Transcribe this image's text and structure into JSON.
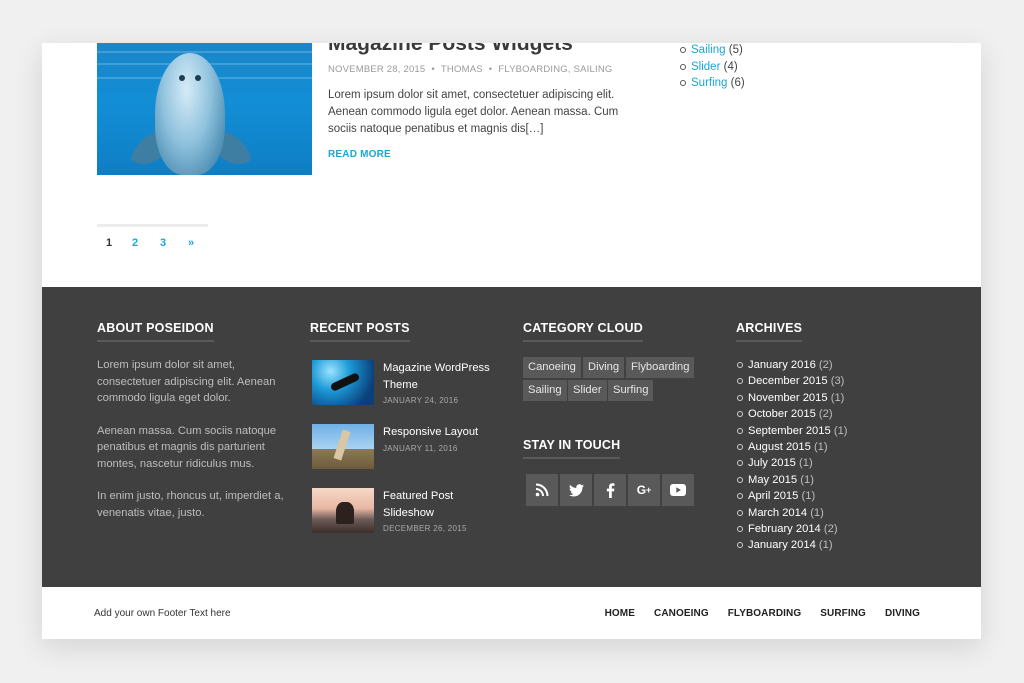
{
  "post": {
    "title": "Magazine Posts Widgets",
    "date": "NOVEMBER 28, 2015",
    "author": "THOMAS",
    "cat1": "FLYBOARDING",
    "cat2": "SAILING",
    "excerpt": "Lorem ipsum dolor sit amet, consectetuer adipiscing elit. Aenean commodo ligula eget dolor. Aenean massa. Cum sociis natoque penatibus et magnis dis[…]",
    "read_more": "READ MORE"
  },
  "sidebar_categories": [
    {
      "name": "Sailing",
      "count": "(5)"
    },
    {
      "name": "Slider",
      "count": "(4)"
    },
    {
      "name": "Surfing",
      "count": "(6)"
    }
  ],
  "pagination": {
    "current": "1",
    "p2": "2",
    "p3": "3",
    "next": "»"
  },
  "about": {
    "title": "ABOUT POSEIDON",
    "p1": "Lorem ipsum dolor sit amet, consectetuer adipiscing elit. Aenean commodo ligula eget dolor.",
    "p2": "Aenean massa. Cum sociis natoque penatibus et magnis dis parturient montes, nascetur ridiculus mus.",
    "p3": "In enim justo, rhoncus ut, imperdiet a, venenatis vitae, justo."
  },
  "recent": {
    "title": "RECENT POSTS",
    "items": [
      {
        "title": "Magazine WordPress Theme",
        "date": "JANUARY 24, 2016"
      },
      {
        "title": "Responsive Layout",
        "date": "JANUARY 11, 2016"
      },
      {
        "title": "Featured Post Slideshow",
        "date": "DECEMBER 26, 2015"
      }
    ]
  },
  "cloud": {
    "title": "CATEGORY CLOUD",
    "tags": [
      "Canoeing",
      "Diving",
      "Flyboarding",
      "Sailing",
      "Slider",
      "Surfing"
    ]
  },
  "social": {
    "title": "STAY IN TOUCH",
    "icons": [
      "rss-icon",
      "twitter-icon",
      "facebook-icon",
      "google-plus-icon",
      "youtube-icon"
    ]
  },
  "archives": {
    "title": "ARCHIVES",
    "items": [
      {
        "month": "January 2016",
        "count": "(2)"
      },
      {
        "month": "December 2015",
        "count": "(3)"
      },
      {
        "month": "November 2015",
        "count": "(1)"
      },
      {
        "month": "October 2015",
        "count": "(2)"
      },
      {
        "month": "September 2015",
        "count": "(1)"
      },
      {
        "month": "August 2015",
        "count": "(1)"
      },
      {
        "month": "July 2015",
        "count": "(1)"
      },
      {
        "month": "May 2015",
        "count": "(1)"
      },
      {
        "month": "April 2015",
        "count": "(1)"
      },
      {
        "month": "March 2014",
        "count": "(1)"
      },
      {
        "month": "February 2014",
        "count": "(2)"
      },
      {
        "month": "January 2014",
        "count": "(1)"
      }
    ]
  },
  "footer": {
    "text": "Add your own Footer Text here",
    "nav": [
      "HOME",
      "CANOEING",
      "FLYBOARDING",
      "SURFING",
      "DIVING"
    ]
  },
  "colors": {
    "accent": "#1aa6d6",
    "footer_bg": "#404040",
    "tag_bg": "#595959"
  }
}
